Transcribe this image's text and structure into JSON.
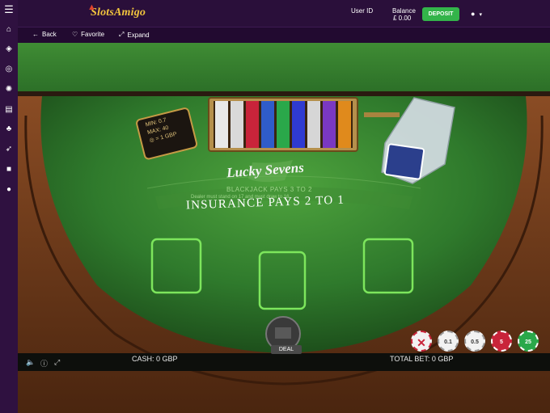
{
  "header": {
    "logo_text": "SlotsAmigo",
    "user_id_label": "User ID",
    "balance_label": "Balance",
    "balance_value": "£ 0.00",
    "deposit_label": "DEPOSIT"
  },
  "subnav": {
    "back_label": "Back",
    "favorite_label": "Favorite",
    "expand_label": "Expand"
  },
  "sidebar": {
    "icons": [
      "menu-icon",
      "home-icon",
      "slots-icon",
      "roulette-icon",
      "casino-chip-icon",
      "cards-icon",
      "table-games-icon",
      "rocket-icon",
      "gift-icon",
      "chat-icon"
    ]
  },
  "game": {
    "limits_min": "MIN: 0.7",
    "limits_max": "MAX: 40",
    "limits_chip": "= 1 GBP",
    "table_logo": "Lucky Sevens",
    "blackjack_pays": "BLACKJACK PAYS 3 TO 2",
    "dealer_rule": "Dealer must stand on 17 and must draw to 16",
    "insurance": "INSURANCE PAYS 2 TO 1",
    "deal_label": "DEAL",
    "cash_label": "CASH:",
    "cash_value": "0 GBP",
    "total_bet_label": "TOTAL BET:",
    "total_bet_value": "0 GBP",
    "chips": [
      {
        "label": "0.1",
        "color": "#f2f2f2"
      },
      {
        "label": "0.5",
        "color": "#f2f2f2"
      },
      {
        "label": "5",
        "color": "#c9243a"
      },
      {
        "label": "25",
        "color": "#2aa84a"
      }
    ],
    "colors": {
      "felt": "#2f7a2c",
      "felt_light": "#4ea33d",
      "wood": "#6b3a1c",
      "accent_purple": "#2a0f3a",
      "deposit_green": "#33b44a"
    }
  }
}
